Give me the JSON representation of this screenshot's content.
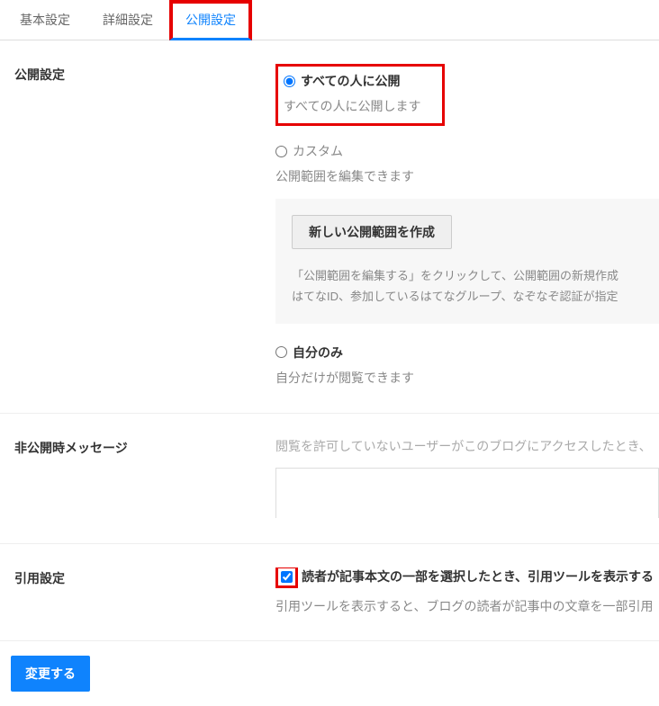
{
  "tabs": {
    "basic": "基本設定",
    "detail": "詳細設定",
    "publish": "公開設定"
  },
  "publish": {
    "section_label": "公開設定",
    "option1": {
      "label": "すべての人に公開",
      "desc": "すべての人に公開します"
    },
    "option2": {
      "label": "カスタム",
      "desc": "公開範囲を編集できます",
      "button": "新しい公開範囲を作成",
      "panel_text_1": "「公開範囲を編集する」をクリックして、公開範囲の新規作成",
      "panel_text_2": "はてなID、参加しているはてなグループ、なぞなぞ認証が指定"
    },
    "option3": {
      "label": "自分のみ",
      "desc": "自分だけが閲覧できます"
    }
  },
  "private_message": {
    "section_label": "非公開時メッセージ",
    "desc": "閲覧を許可していないユーザーがこのブログにアクセスしたとき、"
  },
  "quote": {
    "section_label": "引用設定",
    "checkbox_label": "読者が記事本文の一部を選択したとき、引用ツールを表示する",
    "desc": "引用ツールを表示すると、ブログの読者が記事中の文章を一部引用"
  },
  "submit": {
    "label": "変更する"
  }
}
